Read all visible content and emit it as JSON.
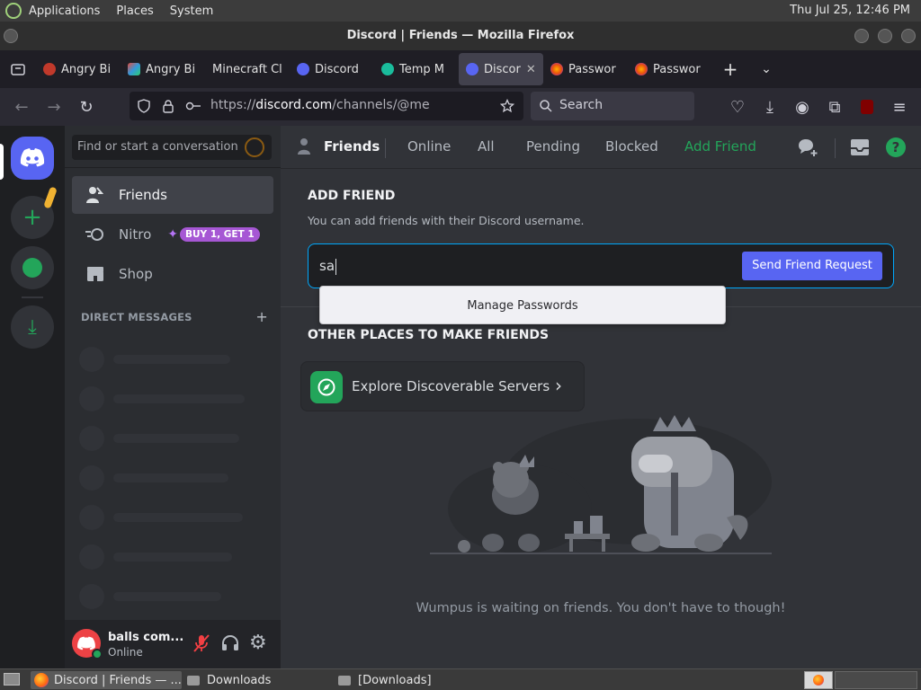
{
  "top_panel": {
    "menus": [
      "Applications",
      "Places",
      "System"
    ],
    "clock": "Thu Jul 25, 12:46 PM"
  },
  "window": {
    "title": "Discord | Friends — Mozilla Firefox"
  },
  "browser": {
    "tabs": [
      {
        "label": "Angry Bi",
        "icon": "angry-birds-favicon",
        "active": false
      },
      {
        "label": "Angry Bi",
        "icon": "angry-birds-favicon-2",
        "active": false
      },
      {
        "label": "Minecraft Cl",
        "icon": "minecraft-favicon",
        "active": false
      },
      {
        "label": "Discord",
        "icon": "discord-favicon",
        "active": false
      },
      {
        "label": "Temp M",
        "icon": "temp-mail-favicon",
        "active": false
      },
      {
        "label": "Discor",
        "icon": "discord-favicon",
        "active": true
      },
      {
        "label": "Passwor",
        "icon": "firefox-favicon",
        "active": false
      },
      {
        "label": "Passwor",
        "icon": "firefox-favicon",
        "active": false
      }
    ],
    "url_prefix": "https://",
    "url_host": "discord.com",
    "url_path": "/channels/@me",
    "search_placeholder": "Search"
  },
  "discord": {
    "search_placeholder": "Find or start a conversation",
    "nav": [
      {
        "label": "Friends",
        "active": true
      },
      {
        "label": "Nitro",
        "active": false
      },
      {
        "label": "Shop",
        "active": false
      }
    ],
    "nitro_badge": "BUY 1, GET 1",
    "direct_messages_header": "DIRECT MESSAGES",
    "direct_messages_add": "+",
    "user": {
      "name": "balls com...",
      "status": "Online"
    },
    "header": {
      "title": "Friends",
      "tabs": [
        "Online",
        "All",
        "Pending",
        "Blocked"
      ],
      "add_friend": "Add Friend"
    },
    "add_friend": {
      "title": "ADD FRIEND",
      "subtitle": "You can add friends with their Discord username.",
      "input_value": "sa",
      "button": "Send Friend Request"
    },
    "autofill_popup": "Manage Passwords",
    "other_places_title": "OTHER PLACES TO MAKE FRIENDS",
    "explore_label": "Explore Discoverable Servers",
    "empty_message": "Wumpus is waiting on friends. You don't have to though!",
    "colors": {
      "blurple": "#5865f2",
      "green": "#23a55a",
      "bg_main": "#313338"
    }
  },
  "taskbar": {
    "items": [
      {
        "label": "Discord | Friends — ...",
        "icon": "firefox-icon",
        "active": true
      },
      {
        "label": "Downloads",
        "icon": "folder-icon",
        "active": false
      },
      {
        "label": "[Downloads]",
        "icon": "folder-icon",
        "active": false
      }
    ]
  }
}
